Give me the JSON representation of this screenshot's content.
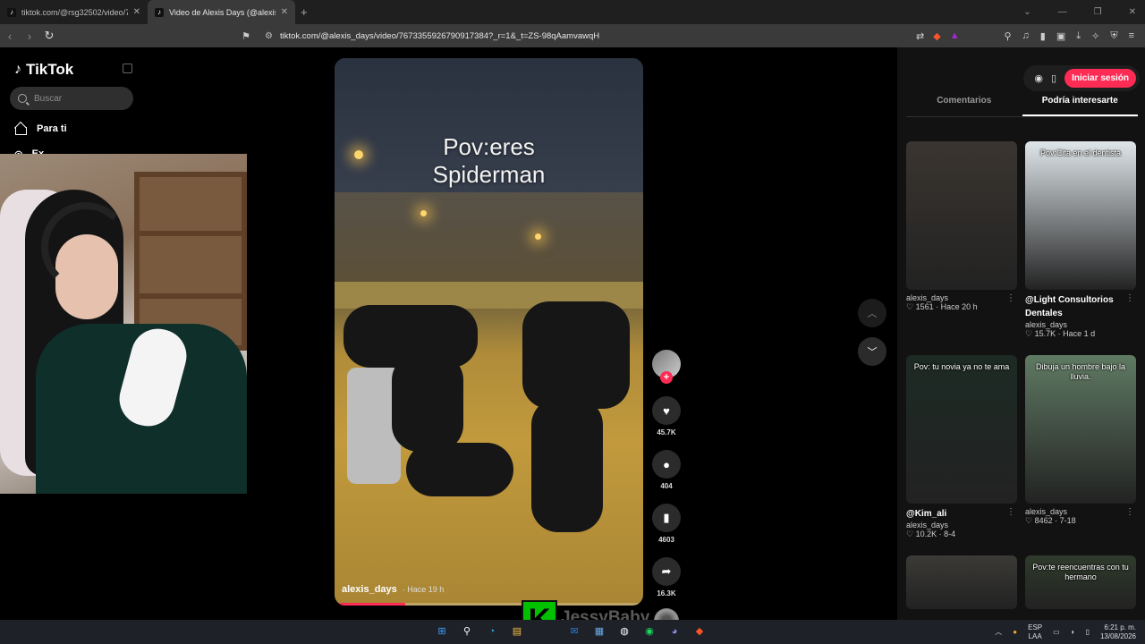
{
  "browser": {
    "tabs": [
      {
        "title": "tiktok.com/@rsg32502/video/76682",
        "active": false
      },
      {
        "title": "Video de Alexis Days (@alexis_d",
        "active": true
      }
    ],
    "new_tab": "+",
    "url": "tiktok.com/@alexis_days/video/7673355926790917384?_r=1&_t=ZS-98qAamvawqH"
  },
  "sidebar": {
    "logo": "TikTok",
    "search_placeholder": "Buscar",
    "items": [
      {
        "label": "Para ti"
      },
      {
        "label": "Ex..."
      }
    ]
  },
  "video": {
    "caption_line1": "Pov:eres",
    "caption_line2": "Spiderman",
    "owner": "alexis_days",
    "time": "· Hace 19 h",
    "progress_fraction": 0.23
  },
  "actions": {
    "likes": "45.7K",
    "comments": "404",
    "saves": "4603",
    "shares": "16.3K"
  },
  "right_panel": {
    "login_label": "Iniciar sesión",
    "tabs": [
      {
        "label": "Comentarios"
      },
      {
        "label": "Podría interesarte"
      }
    ],
    "cards": [
      {
        "overlay": "",
        "caption": "",
        "user": "alexis_days",
        "stats": "♡ 1561 · Hace 20 h",
        "color": "#3a3530"
      },
      {
        "overlay": "Pov:Cita en el dentista",
        "caption": "@Light Consultorios Dentales",
        "user": "alexis_days",
        "stats": "♡ 15.7K · Hace 1 d",
        "color": "#dfe6ea"
      },
      {
        "overlay": "Pov: tu novia ya no te ama",
        "caption": "@Kim_ali",
        "user": "alexis_days",
        "stats": "♡ 10.2K · 8-4",
        "color": "#1d2a24"
      },
      {
        "overlay": "Dibuja un hombre bajo la lluvia.",
        "caption": "",
        "user": "alexis_days",
        "stats": "♡ 8462 · 7-18",
        "color": "#5f7a63"
      },
      {
        "overlay": "",
        "caption": "",
        "user": "",
        "stats": "",
        "color": "#3b3a36"
      },
      {
        "overlay": "Pov:te reencuentras con tu hermano",
        "caption": "",
        "user": "",
        "stats": "",
        "color": "#2f3b2c"
      }
    ]
  },
  "overlay": {
    "sticker": "K",
    "watermark": "JessyBaby"
  },
  "taskbar": {
    "lang": "ESP",
    "lang2": "LAA",
    "time": "6:21 p. m.",
    "date": "13/08/2026"
  },
  "colors": {
    "accent": "#fe2c55"
  }
}
